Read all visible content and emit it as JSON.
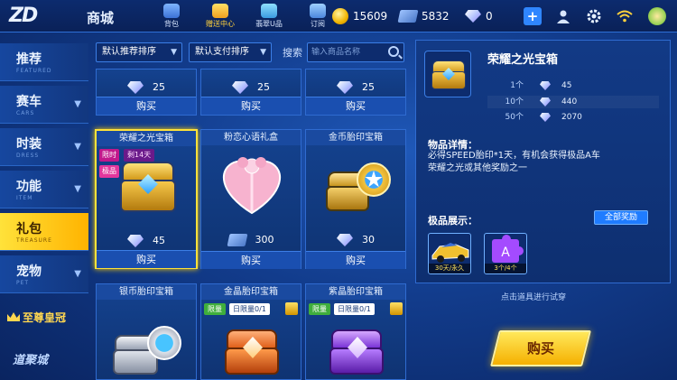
{
  "app": {
    "logo_text": "ZD",
    "section_title": "商城"
  },
  "top_nav": [
    {
      "label": "背包",
      "icon": "bag-icon",
      "active": false
    },
    {
      "label": "赠送中心",
      "icon": "gift-center-icon",
      "active": true
    },
    {
      "label": "翡翠U品",
      "icon": "u-shop-icon",
      "active": false
    },
    {
      "label": "订阅",
      "icon": "subscribe-icon",
      "active": false
    }
  ],
  "currencies": {
    "coins": "15609",
    "vouchers": "5832",
    "gems": "0"
  },
  "sidebar": {
    "items": [
      {
        "label": "推荐",
        "sub": "FEATURED",
        "has_caret": false,
        "active": false
      },
      {
        "label": "赛车",
        "sub": "CARS",
        "has_caret": true,
        "active": false
      },
      {
        "label": "时装",
        "sub": "DRESS",
        "has_caret": true,
        "active": false
      },
      {
        "label": "功能",
        "sub": "ITEM",
        "has_caret": true,
        "active": false
      },
      {
        "label": "礼包",
        "sub": "TREASURE",
        "has_caret": false,
        "active": true
      },
      {
        "label": "宠物",
        "sub": "PET",
        "has_caret": true,
        "active": false
      }
    ],
    "crown_label": "至尊皇冠",
    "bottom_label": "道聚城"
  },
  "filters": {
    "sort_recommend": "默认推荐排序",
    "sort_pay": "默认支付排序",
    "search_label": "搜索",
    "search_placeholder": "输入商品名称"
  },
  "top_row": [
    {
      "price": "25",
      "buy": "购买"
    },
    {
      "price": "25",
      "buy": "购买"
    },
    {
      "price": "25",
      "buy": "购买"
    }
  ],
  "mid_row": [
    {
      "name": "荣耀之光宝箱",
      "price": "45",
      "currency": "gem",
      "buy": "购买",
      "tag_limit": "限时",
      "tag_days": "剩14天",
      "tag_top": "极品",
      "selected": true
    },
    {
      "name": "粉恋心语礼盒",
      "price": "300",
      "currency": "voucher",
      "buy": "购买",
      "selected": false
    },
    {
      "name": "金币胎印宝箱",
      "price": "30",
      "currency": "gem",
      "buy": "购买",
      "selected": false
    }
  ],
  "bottom_row": [
    {
      "name": "银币胎印宝箱"
    },
    {
      "name": "金晶胎印宝箱",
      "tag": "限量",
      "daily": "日限量0/1"
    },
    {
      "name": "紫晶胎印宝箱",
      "tag": "限量",
      "daily": "日限量0/1"
    }
  ],
  "detail": {
    "title": "荣耀之光宝箱",
    "prices": [
      {
        "qty": "1个",
        "value": "45"
      },
      {
        "qty": "10个",
        "value": "440"
      },
      {
        "qty": "50个",
        "value": "2070"
      }
    ],
    "desc_head": "物品详情：",
    "desc_body": "必得SPEED胎印*1天，有机会获得极品A车荣耀之光或其他奖励之一",
    "showcase_head": "极品展示：",
    "all_rewards": "全部奖励",
    "rewards": [
      {
        "caption": "30天/永久",
        "icon": "race-car-icon"
      },
      {
        "caption": "3个/4个",
        "icon": "puzzle-piece-icon"
      }
    ],
    "tryon_hint": "点击道具进行试穿",
    "buy_label": "购买"
  },
  "colors": {
    "accent": "#ffe23a",
    "background": "#123c8c",
    "buy_button": "#f5b000"
  }
}
